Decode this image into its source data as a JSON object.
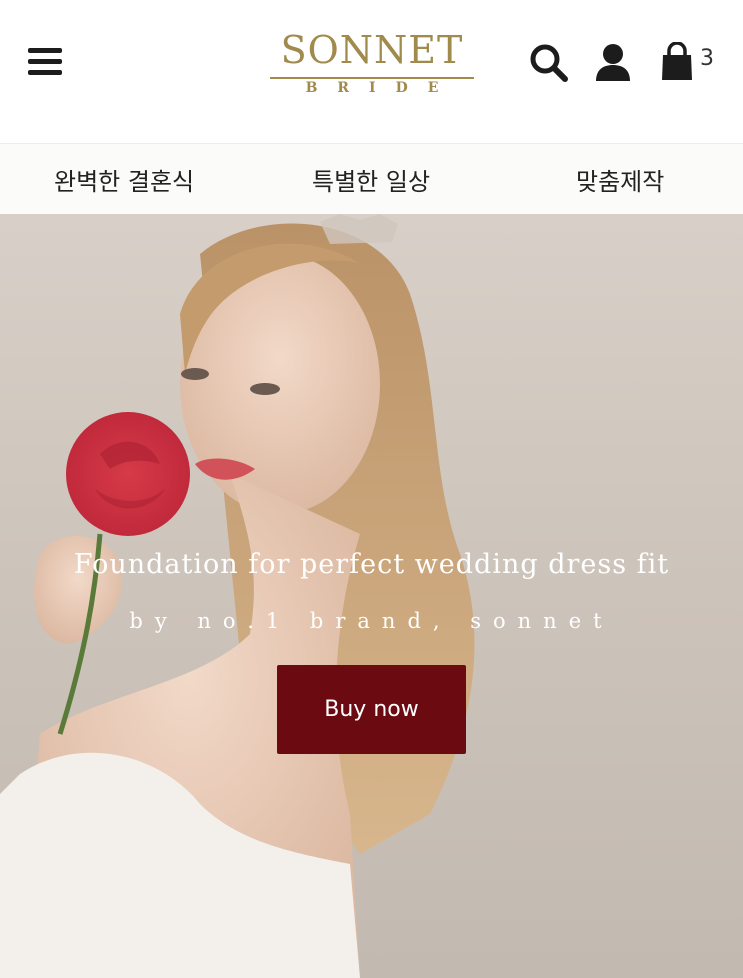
{
  "header": {
    "logo_main": "SONNET",
    "logo_sub": "BRIDE",
    "cart_count": "3",
    "accent_color": "#a08a4c"
  },
  "icons": {
    "menu": "hamburger-menu-icon",
    "search": "search-icon",
    "account": "user-icon",
    "cart": "shopping-bag-icon"
  },
  "nav": {
    "items": [
      {
        "label": "완벽한 결혼식"
      },
      {
        "label": "특별한 일상"
      },
      {
        "label": "맞춤제작"
      }
    ]
  },
  "hero": {
    "title": "Foundation for perfect wedding dress fit",
    "subtitle": "by no.1 brand, sonnet",
    "button_label": "Buy now",
    "button_color": "#6b0a10"
  }
}
